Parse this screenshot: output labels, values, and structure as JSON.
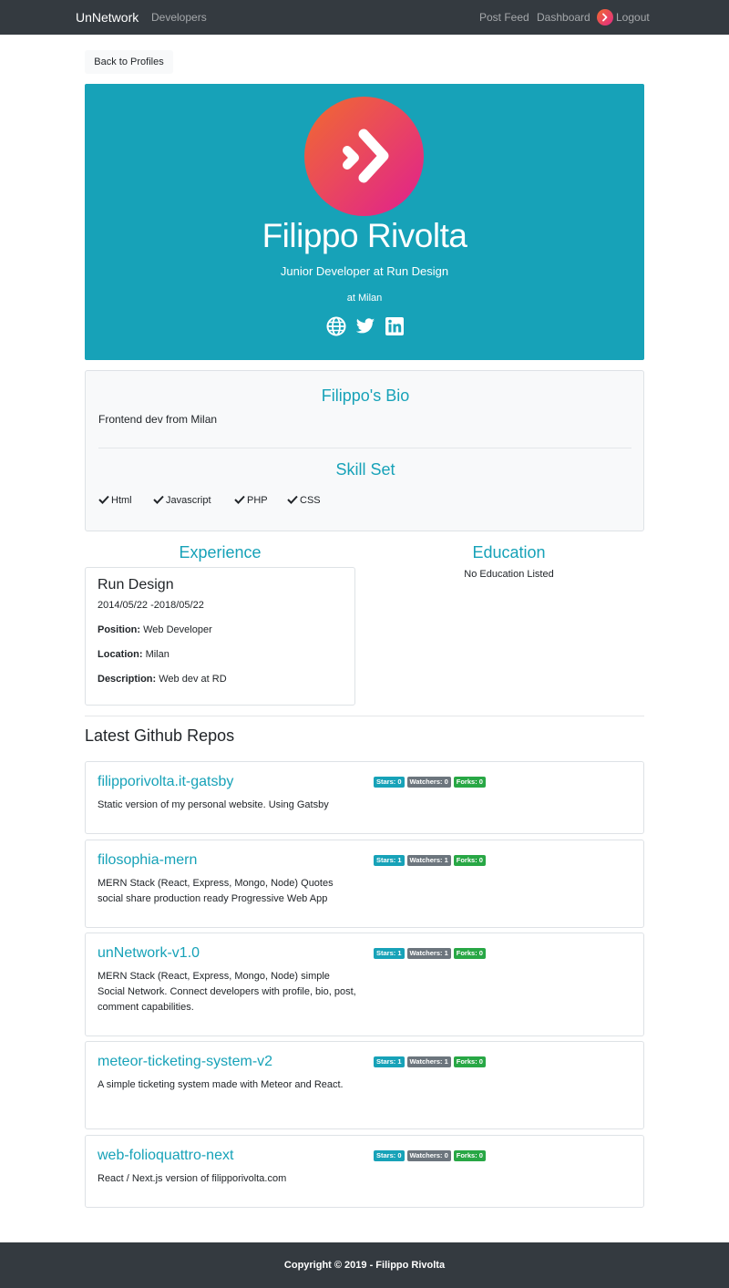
{
  "nav": {
    "brand": "UnNetwork",
    "developers": "Developers",
    "post_feed": "Post Feed",
    "dashboard": "Dashboard",
    "logout": "Logout"
  },
  "back_button": "Back to Profiles",
  "profile": {
    "name": "Filippo Rivolta",
    "status": "Junior Developer at Run Design",
    "location": "at Milan",
    "social_icons": [
      "globe-icon",
      "twitter-icon",
      "linkedin-icon"
    ]
  },
  "bio": {
    "title": "Filippo's Bio",
    "text": "Frontend dev from Milan",
    "skills_title": "Skill Set",
    "skills": [
      "Html",
      "Javascript",
      "PHP",
      "CSS"
    ]
  },
  "experience": {
    "title": "Experience",
    "items": [
      {
        "company": "Run Design",
        "dates": "2014/05/22 -2018/05/22",
        "position_label": "Position:",
        "position": "Web Developer",
        "location_label": "Location:",
        "location": "Milan",
        "description_label": "Description:",
        "description": "Web dev at RD"
      }
    ]
  },
  "education": {
    "title": "Education",
    "empty": "No Education Listed"
  },
  "repos": {
    "title": "Latest Github Repos",
    "items": [
      {
        "name": "filipporivolta.it-gatsby",
        "description": "Static version of my personal website. Using Gatsby",
        "stars": "Stars: 0",
        "watchers": "Watchers: 0",
        "forks": "Forks: 0"
      },
      {
        "name": "filosophia-mern",
        "description": "MERN Stack (React, Express, Mongo, Node) Quotes social share production ready Progressive Web App",
        "stars": "Stars: 1",
        "watchers": "Watchers: 1",
        "forks": "Forks: 0"
      },
      {
        "name": "unNetwork-v1.0",
        "description": "MERN Stack (React, Express, Mongo, Node) simple Social Network. Connect developers with profile, bio, post, comment capabilities.",
        "stars": "Stars: 1",
        "watchers": "Watchers: 1",
        "forks": "Forks: 0"
      },
      {
        "name": "meteor-ticketing-system-v2",
        "description": "A simple ticketing system made with Meteor and React.",
        "stars": "Stars: 1",
        "watchers": "Watchers: 1",
        "forks": "Forks: 0"
      },
      {
        "name": "web-folioquattro-next",
        "description": "React / Next.js version of filipporivolta.com",
        "stars": "Stars: 0",
        "watchers": "Watchers: 0",
        "forks": "Forks: 0"
      }
    ]
  },
  "footer": "Copyright © 2019 - Filippo Rivolta",
  "colors": {
    "primary": "#17a2b8",
    "dark": "#343a40",
    "secondary": "#6c757d",
    "success": "#28a745",
    "light": "#f8f9fa"
  }
}
